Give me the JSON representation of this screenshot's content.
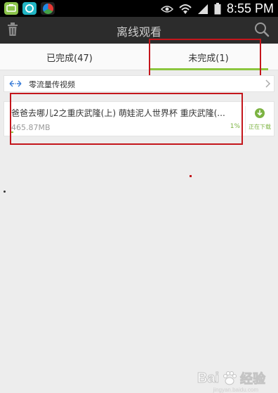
{
  "status_bar": {
    "time": "8:55 PM",
    "app_icons": [
      "green-app-icon",
      "cyan-app-icon",
      "swirl-app-icon"
    ],
    "indicators": [
      "eye-icon",
      "wifi-icon",
      "signal-icon",
      "battery-icon"
    ]
  },
  "header": {
    "title": "离线观看"
  },
  "tabs": [
    {
      "label": "已完成(47)",
      "active": false
    },
    {
      "label": "未完成(1)",
      "active": true
    }
  ],
  "zero_traffic": {
    "label": "零流量传视频"
  },
  "downloads": [
    {
      "title": "爸爸去哪儿2之重庆武隆(上)  萌娃泥人世界杯  重庆武隆(...",
      "size": "465.87MB",
      "percent": "1%",
      "progress": 0.01,
      "status": "正在下载"
    }
  ],
  "watermark": {
    "brand": "Bai",
    "brand_suffix": "经验",
    "url": "jingyan.baidu.com"
  },
  "colors": {
    "accent_green": "#8cc63f",
    "annotation_red": "#c4161c",
    "titlebar": "#2c2c2c"
  }
}
